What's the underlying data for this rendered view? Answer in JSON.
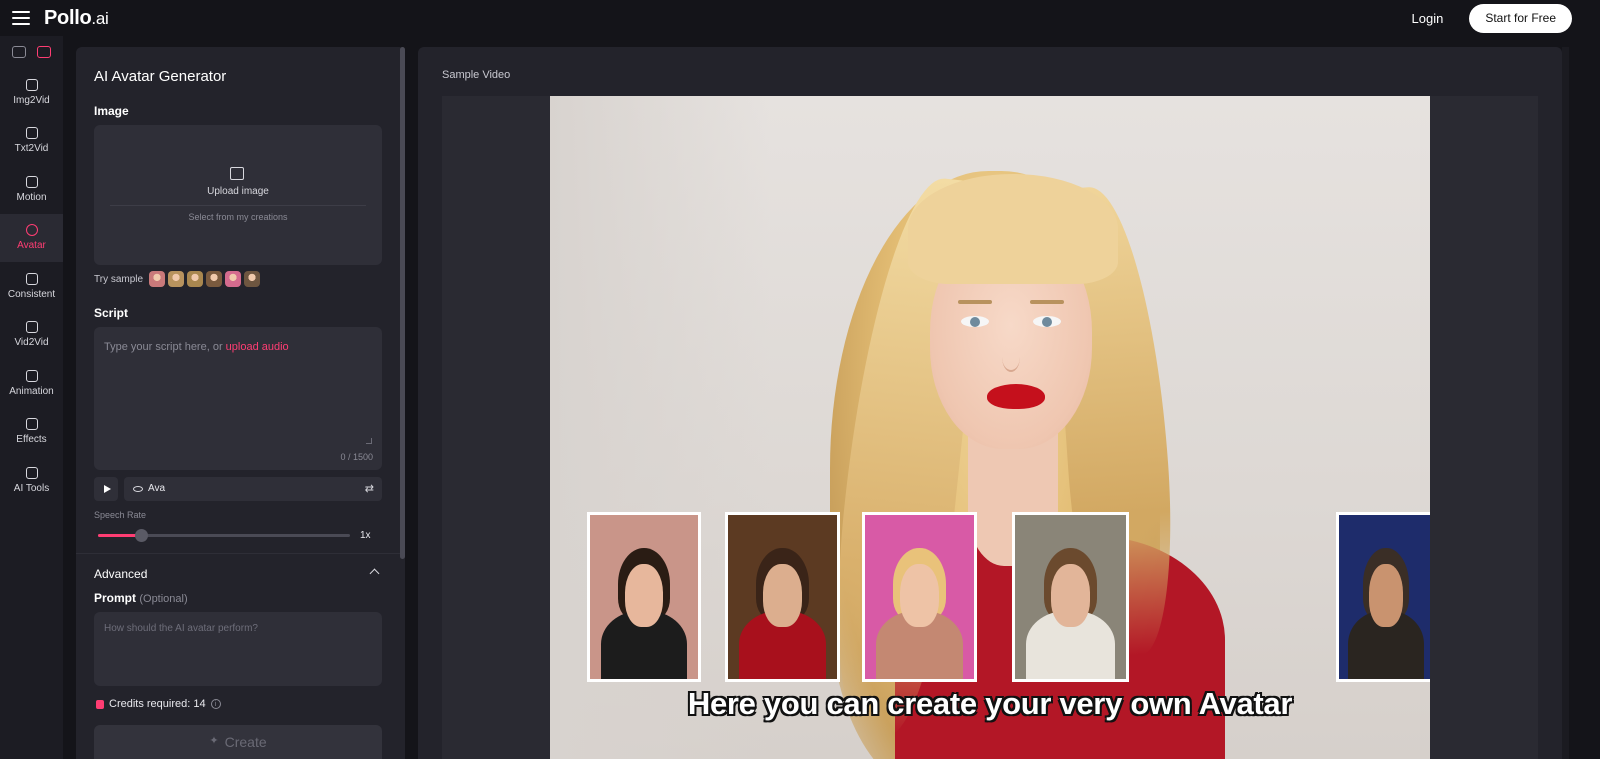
{
  "app": {
    "logo_main": "Pollo",
    "logo_suffix": ".ai",
    "login_label": "Login",
    "start_label": "Start for Free"
  },
  "rail": {
    "top_icons": [
      "image-icon",
      "video-icon"
    ],
    "items": [
      {
        "label": "Img2Vid",
        "icon": "img2vid-icon"
      },
      {
        "label": "Txt2Vid",
        "icon": "txt2vid-icon"
      },
      {
        "label": "Motion",
        "icon": "motion-icon"
      },
      {
        "label": "Avatar",
        "icon": "avatar-icon",
        "active": true
      },
      {
        "label": "Consistent",
        "icon": "consistent-icon"
      },
      {
        "label": "Vid2Vid",
        "icon": "vid2vid-icon"
      },
      {
        "label": "Animation",
        "icon": "animation-icon"
      },
      {
        "label": "Effects",
        "icon": "effects-icon"
      },
      {
        "label": "AI Tools",
        "icon": "ai-tools-icon"
      }
    ]
  },
  "form": {
    "title": "AI Avatar Generator",
    "image_label": "Image",
    "upload_label": "Upload image",
    "select_creations": "Select from my creations",
    "try_sample": "Try sample",
    "script_label": "Script",
    "script_placeholder": "Type your script here, or ",
    "upload_audio": "upload audio",
    "char_count": "0 / 1500",
    "voice": "Ava",
    "speech_rate_label": "Speech Rate",
    "speech_rate_value": "1x",
    "speech_rate_fraction": 0.17,
    "advanced_label": "Advanced",
    "prompt_label": "Prompt",
    "prompt_optional": "(Optional)",
    "prompt_placeholder": "How should the AI avatar perform?",
    "credits": "Credits required: 14",
    "create_label": "Create"
  },
  "colors": {
    "accent": "#ff3d73",
    "sample_thumbs": [
      "#c9797a",
      "#b8935e",
      "#a9874f",
      "#7a5a3e",
      "#d46b8e",
      "#6e5640"
    ],
    "card_bgs": [
      "#c99589",
      "#5c3a22",
      "#d85aa6",
      "#8a8578",
      "#1e2c6b"
    ],
    "card_bodies": [
      "#1c1c1c",
      "#a8101c",
      "#c48872",
      "#e8e4dc",
      "#2a2520"
    ],
    "card_heads": [
      "#e7b79c",
      "#dcae8e",
      "#eec3a6",
      "#e2b599",
      "#c9936f"
    ],
    "card_hairs": [
      "#2a1c14",
      "#3a2418",
      "#e9c27a",
      "#6b4a2e",
      "#3a2e26"
    ]
  },
  "video": {
    "title": "Sample Video",
    "caption": "Here you can create your very own Avatar"
  }
}
